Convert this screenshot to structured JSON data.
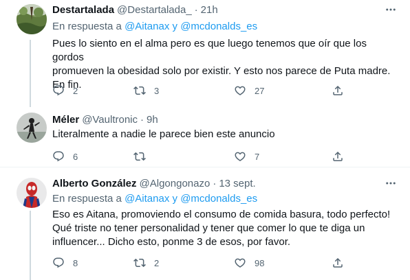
{
  "tweets": [
    {
      "name": "Destartalada",
      "handle": "@Destartalada_",
      "separator": "·",
      "time": "21h",
      "reply_prefix": "En respuesta a",
      "reply_users": [
        "@Aitanax",
        "@mcdonalds_es"
      ],
      "reply_joiner": "y",
      "text_lines": [
        "Pues lo siento en el alma pero es que luego tenemos que oír que los gordos",
        "promueven la obesidad solo por existir. Y esto nos parece de Puta madre.",
        "En fin."
      ],
      "replies": "2",
      "retweets": "3",
      "likes": "27",
      "avatar_icon": "landscape-avatar-photo"
    },
    {
      "name": "Méler",
      "handle": "@Vaultronic",
      "separator": "·",
      "time": "9h",
      "text_lines": [
        "Literalmente a nadie le parece bien este anuncio"
      ],
      "replies": "6",
      "retweets": "",
      "likes": "7",
      "avatar_icon": "figure-avatar-photo"
    },
    {
      "name": "Alberto González",
      "handle": "@Algongonazo",
      "separator": "·",
      "time": "13 sept.",
      "reply_prefix": "En respuesta a",
      "reply_users": [
        "@Aitanax",
        "@mcdonalds_es"
      ],
      "reply_joiner": "y",
      "text_lines": [
        "Eso es Aitana, promoviendo el consumo de comida basura, todo perfecto!",
        "Qué triste no tener personalidad y tener que comer lo que te diga un",
        "influencer... Dicho esto, ponme 3 de esos, por favor."
      ],
      "replies": "8",
      "retweets": "2",
      "likes": "98",
      "avatar_icon": "spiderman-avatar-photo"
    }
  ],
  "colors": {
    "text": "#0f1419",
    "secondary": "#536471",
    "link": "#1d9bf0",
    "divider": "#eff3f4",
    "thread_line": "#cfd9de"
  },
  "icons": [
    "more-icon",
    "reply-icon",
    "retweet-icon",
    "like-icon",
    "share-icon"
  ]
}
